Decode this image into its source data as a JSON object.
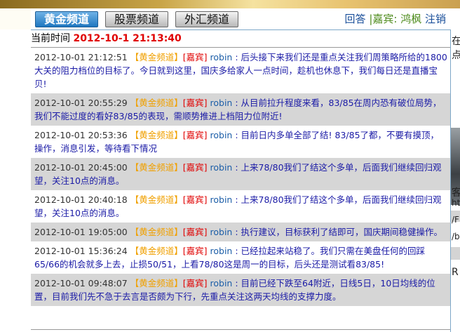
{
  "nav": {
    "tabs": [
      {
        "label": "黄金频道",
        "active": true
      },
      {
        "label": "股票频道",
        "active": false
      },
      {
        "label": "外汇频道",
        "active": false
      }
    ],
    "reply_label": "回答",
    "guest_label": "|嘉宾: 鸿枫",
    "logout_label": "注销"
  },
  "status": {
    "time_label": "当前时间",
    "time_value": "2012-10-1 21:13:40"
  },
  "messages": [
    {
      "datetime": "2012-10-01 21:12:51",
      "channel": "【黄金频道】",
      "role": "[嘉宾]",
      "user": "robin",
      "text": ": 后头接下来我们还是重点关注我们周策略所给的1800大关的阻力档位的目标了。今日就到这里，国庆多给家人一点时间，趁机也休息下，我们每日还是直播宝贝!"
    },
    {
      "datetime": "2012-10-01 20:55:29",
      "channel": "【黄金频道】",
      "role": "[嘉宾]",
      "user": "robin",
      "text": ": 从目前拉升程度来看，83/85在周内恐有破位局势，我们不能过度的看好83/85的表现，需顺势推进上档阻力位附近!"
    },
    {
      "datetime": "2012-10-01 20:53:36",
      "channel": "【黄金频道】",
      "role": "[嘉宾]",
      "user": "robin",
      "text": ": 目前日内多单全部了结! 83/85了都，不要有摸顶，操作，消息引发，等待看下情况"
    },
    {
      "datetime": "2012-10-01 20:45:00",
      "channel": "【黄金频道】",
      "role": "[嘉宾]",
      "user": "robin",
      "text": ": 上来78/80我们了结这个多单，后面我们继续回归观望，关注10点的消息。"
    },
    {
      "datetime": "2012-10-01 20:40:18",
      "channel": "【黄金频道】",
      "role": "[嘉宾]",
      "user": "robin",
      "text": ": 上来78/80我们了结这个多单，后面我们继续回归观望，关注10点的消息。"
    },
    {
      "datetime": "2012-10-01 19:05:00",
      "channel": "【黄金频道】",
      "role": "[嘉宾]",
      "user": "robin",
      "text": ": 执行建议，目标获利了结即可，国庆期间稳健操作。"
    },
    {
      "datetime": "2012-10-01 15:36:24",
      "channel": "【黄金频道】",
      "role": "[嘉宾]",
      "user": "robin",
      "text": ": 已经拉起来站稳了。我们只需在美盘任何的回踩65/66的机会就多上去，止损50/51，上看78/80这是周一的目标，后头还是测试看83/85!"
    },
    {
      "datetime": "2012-10-01 09:48:07",
      "channel": "【黄金频道】",
      "role": "[嘉宾]",
      "user": "robin",
      "text": ": 目前已经下跌至64附近，日线5日，10日均线的位置，目前我们先不急于去言是否颇为下行，先重点关注这两天均线的支撑力度。"
    }
  ],
  "side_panel": {
    "fragments": [
      "在",
      "点",
      "客",
      "ht",
      "/F",
      "/b",
      "R"
    ]
  }
}
